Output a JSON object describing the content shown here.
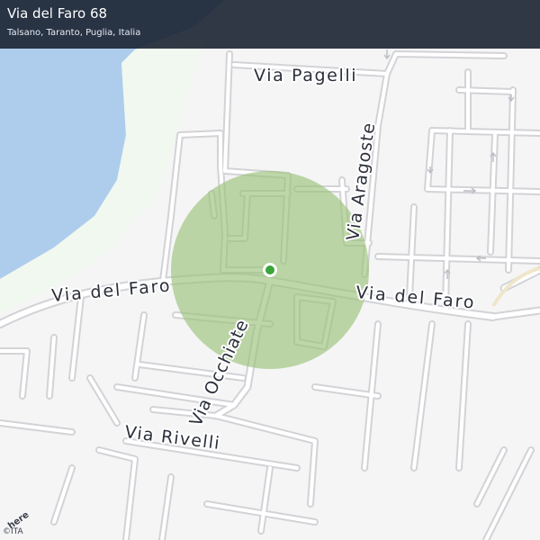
{
  "header": {
    "title": "Via del Faro 68",
    "subtitle": "Talsano, Taranto, Puglia, Italia"
  },
  "map": {
    "streets": [
      {
        "name": "Via Pagelli"
      },
      {
        "name": "Via Aragoste"
      },
      {
        "name": "Via del Faro"
      },
      {
        "name": "Via del Faro"
      },
      {
        "name": "Via Occhiate"
      },
      {
        "name": "Via Rivelli"
      }
    ],
    "marker_color": "#3aa53a",
    "radius_color": "#9bc17a",
    "water_color": "#aecdec"
  },
  "footer": {
    "logo": "here",
    "copyright": "©ITA"
  }
}
